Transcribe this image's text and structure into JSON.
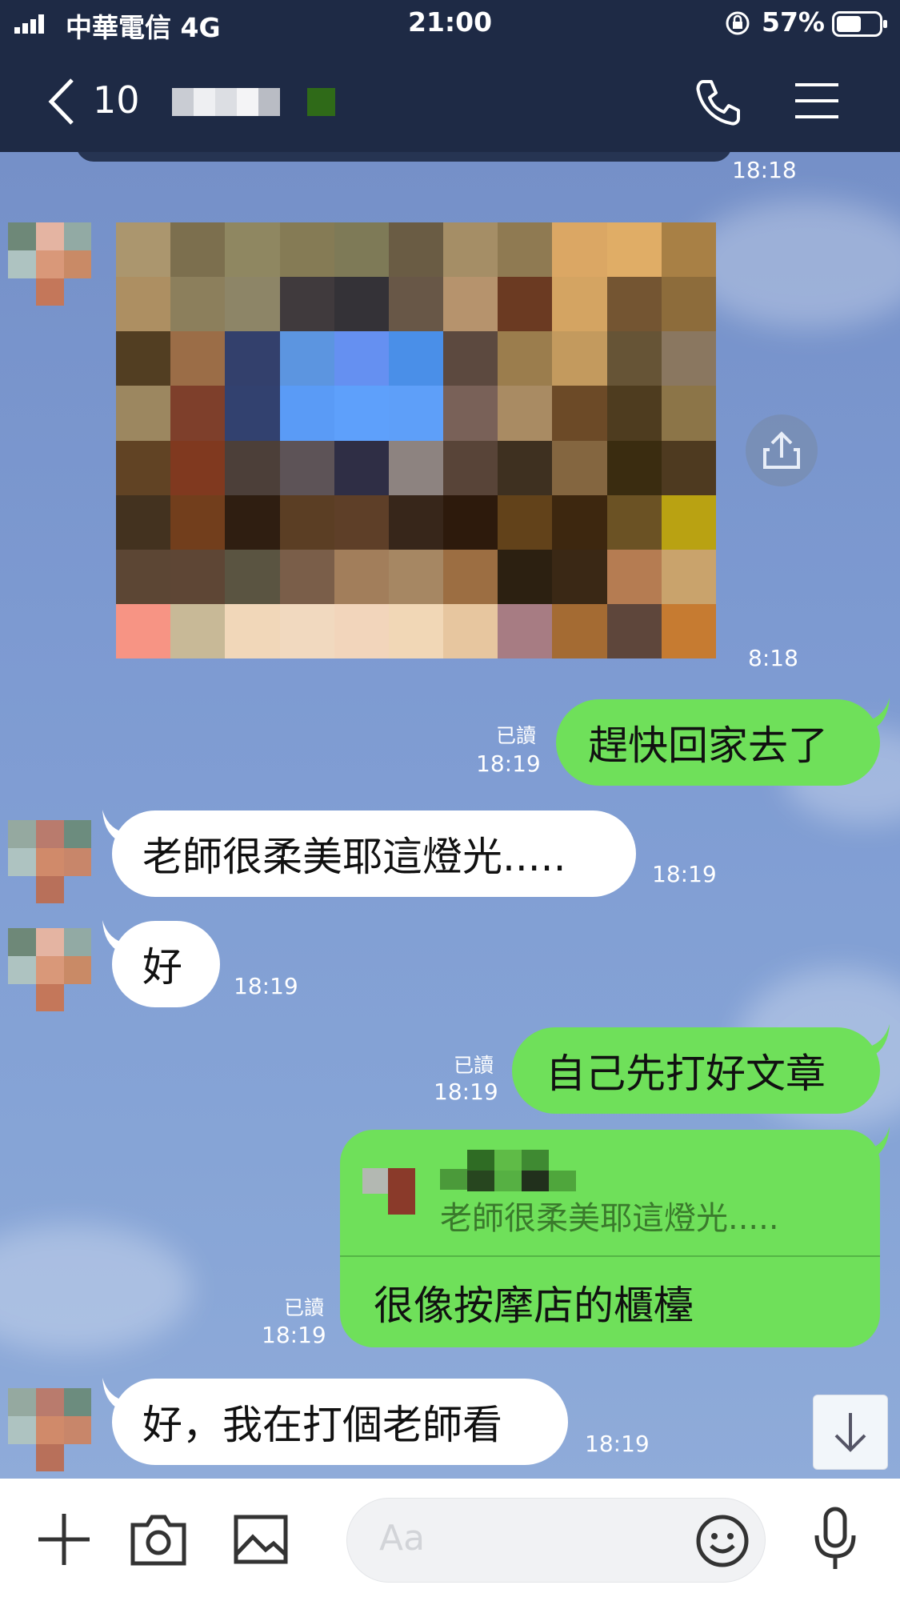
{
  "status_bar": {
    "carrier": "中華電信 4G",
    "time": "21:00",
    "battery": "57%"
  },
  "header": {
    "back_count": "10",
    "icons": [
      "chevron-left-icon",
      "phone-icon",
      "menu-icon"
    ],
    "color": "#1e2a45"
  },
  "messages": [
    {
      "id": "m0",
      "side": "left",
      "type": "image",
      "time": "18:18"
    },
    {
      "id": "m1",
      "side": "left",
      "type": "image",
      "time": "8:18"
    },
    {
      "id": "m2",
      "side": "right",
      "read": "已讀",
      "time": "18:19",
      "text": "趕快回家去了"
    },
    {
      "id": "m3",
      "side": "left",
      "time": "18:19",
      "text": "老師很柔美耶這燈光....."
    },
    {
      "id": "m4",
      "side": "left",
      "time": "18:19",
      "text": "好"
    },
    {
      "id": "m5",
      "side": "right",
      "read": "已讀",
      "time": "18:19",
      "text": "自己先打好文章"
    },
    {
      "id": "m6",
      "side": "right",
      "read": "已讀",
      "time": "18:19",
      "quote": "老師很柔美耶這燈光.....",
      "text": "很像按摩店的櫃檯"
    },
    {
      "id": "m7",
      "side": "left",
      "time": "18:19",
      "text": "好，我在打個老師看"
    }
  ],
  "input": {
    "placeholder": "Aa",
    "icons": [
      "plus-icon",
      "camera-icon",
      "image-icon",
      "emoji-icon",
      "microphone-icon"
    ]
  },
  "colors": {
    "green_bubble": "#6fe05a",
    "white_bubble": "#ffffff",
    "chat_background": "#7d9ad0"
  }
}
